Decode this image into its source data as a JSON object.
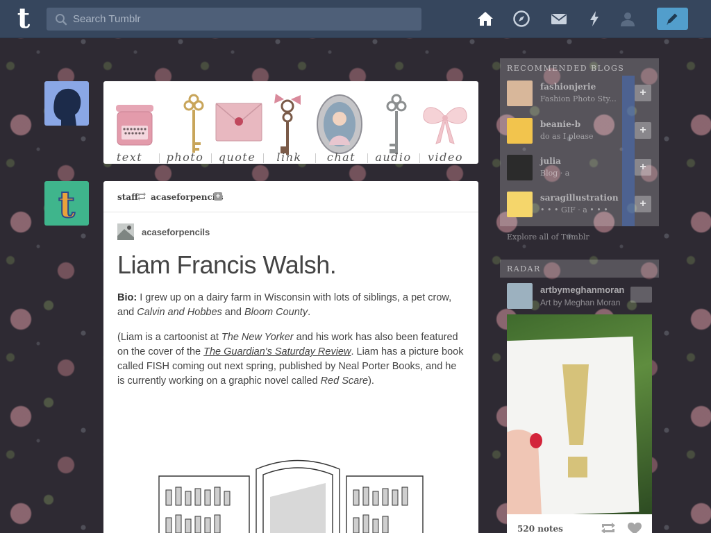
{
  "header": {
    "logo": "t",
    "search": {
      "placeholder": "Search Tumblr"
    },
    "nav": [
      "home-icon",
      "explore-icon",
      "inbox-icon",
      "activity-icon",
      "account-icon"
    ],
    "compose": "pencil-icon"
  },
  "post_types": [
    {
      "label": "text"
    },
    {
      "label": "photo"
    },
    {
      "label": "quote"
    },
    {
      "label": "link"
    },
    {
      "label": "chat"
    },
    {
      "label": "audio"
    },
    {
      "label": "video"
    }
  ],
  "post": {
    "reblogger": "staff",
    "source": "acaseforpencils",
    "author": "acaseforpencils",
    "title": "Liam Francis Walsh.",
    "bio_label": "Bio:",
    "bio_text_1": " I grew up on a dairy farm in Wisconsin with lots of siblings, a pet crow, and ",
    "bio_italic_1": "Calvin and Hobbes",
    "bio_text_2": " and ",
    "bio_italic_2": "Bloom County",
    "bio_text_3": ".",
    "p2_text_1": "(Liam is a cartoonist at ",
    "p2_italic_1": "The New Yorker",
    "p2_text_2": " and his work has also been featured on the cover of the ",
    "p2_link": "The Guardian's Saturday Review",
    "p2_text_3": ". Liam has a picture book called FISH coming out next spring, published by Neal Porter Books, and he is currently working on a graphic novel called ",
    "p2_italic_2": "Red Scare",
    "p2_text_4": ")."
  },
  "sidebar": {
    "recommended_title": "Recommended Blogs",
    "recommended": [
      {
        "name": "fashionjerie",
        "sub": "Fashion Photo Sty..."
      },
      {
        "name": "beanie-b",
        "sub": "do as I please"
      },
      {
        "name": "julia",
        "sub": "Blog · a"
      },
      {
        "name": "saragillustration",
        "sub": "• • • GIF · a • • •"
      }
    ],
    "explore": "Explore all of Tumblr",
    "radar_title": "Radar",
    "radar_user": "artbymeghanmoran",
    "radar_sub": "Art by Meghan Moran",
    "notes": "520 notes"
  }
}
